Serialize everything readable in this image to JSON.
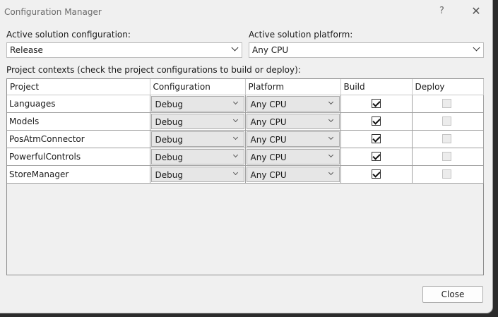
{
  "window": {
    "title": "Configuration Manager",
    "help_glyph": "?",
    "close_glyph": "✕"
  },
  "config": {
    "label": "Active solution configuration:",
    "value": "Release"
  },
  "platform": {
    "label": "Active solution platform:",
    "value": "Any CPU"
  },
  "contexts": {
    "label": "Project contexts (check the project configurations to build or deploy):",
    "columns": [
      "Project",
      "Configuration",
      "Platform",
      "Build",
      "Deploy"
    ],
    "rows": [
      {
        "project": "Languages",
        "configuration": "Debug",
        "platform": "Any CPU",
        "build": true,
        "deploy": false
      },
      {
        "project": "Models",
        "configuration": "Debug",
        "platform": "Any CPU",
        "build": true,
        "deploy": false
      },
      {
        "project": "PosAtmConnector",
        "configuration": "Debug",
        "platform": "Any CPU",
        "build": true,
        "deploy": false
      },
      {
        "project": "PowerfulControls",
        "configuration": "Debug",
        "platform": "Any CPU",
        "build": true,
        "deploy": false
      },
      {
        "project": "StoreManager",
        "configuration": "Debug",
        "platform": "Any CPU",
        "build": true,
        "deploy": false
      }
    ]
  },
  "buttons": {
    "close_label": "Close"
  }
}
